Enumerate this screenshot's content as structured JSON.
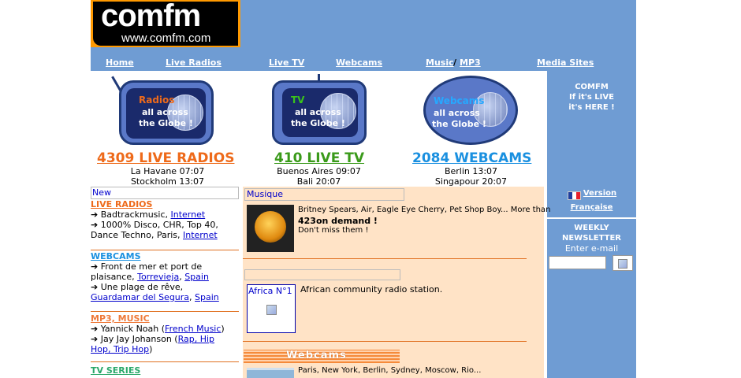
{
  "logo": {
    "name": "comfm",
    "url": "www.comfm.com"
  },
  "nav": {
    "home": "Home",
    "live_radios": "Live Radios",
    "live_tv": "Live TV",
    "webcams": "Webcams",
    "music": "Music",
    "separator": "/",
    "mp3": "MP3",
    "media_sites": "Media Sites"
  },
  "hero": {
    "radios": {
      "category": "Radios",
      "line1": "all across",
      "line2": "the Globe !",
      "count": "4309 LIVE RADIOS",
      "city1": "La Havane 07:07",
      "city2": "Stockholm 13:07",
      "color": "#ee6a1a"
    },
    "tv": {
      "category": "TV",
      "line1": "all across",
      "line2": "the Globe !",
      "count": "410 LIVE TV",
      "city1": "Buenos Aires 09:07",
      "city2": "Bali 20:07",
      "color": "#3a9a1a"
    },
    "webcams": {
      "category": "Webcams",
      "line1": "all across",
      "line2": "the Globe !",
      "count": "2084 WEBCAMS",
      "city1": "Berlin 13:07",
      "city2": "Singapour 20:07",
      "color": "#1a90e0"
    }
  },
  "right": {
    "tagline1": "COMFM",
    "tagline2": "If it's LIVE",
    "tagline3": "it's HERE !",
    "version1": "Version",
    "version2": "Française",
    "newsletter1": "WEEKLY",
    "newsletter2": "NEWSLETTER",
    "enter_email": "Enter e-mail",
    "email_value": ""
  },
  "left": {
    "new_label": "New",
    "radios": {
      "title": "LIVE RADIOS",
      "items": [
        {
          "text": "Badtrackmusic, ",
          "link": "Internet"
        },
        {
          "text": "1000% Disco, CHR, Top 40,",
          "text2": "Dance Techno, Paris, ",
          "link": "Internet"
        }
      ]
    },
    "webcams": {
      "title": "WEBCAMS",
      "item1_a": "Front de mer et port de",
      "item1_b": "plaisance, ",
      "item1_link1": "Torrevieja",
      "item1_sep": ", ",
      "item1_link2": "Spain",
      "item2_a": "Une plage de rêve,",
      "item2_link1": "Guardamar del Segura",
      "item2_sep": ", ",
      "item2_link2": "Spain"
    },
    "music": {
      "title": "MP3, MUSIC",
      "item1_a": "Yannick Noah (",
      "item1_link": "French Music",
      "item1_b": ")",
      "item2_a": "Jay Jay Johanson (",
      "item2_link1": "Rap, Hip",
      "item2_link2": "Hop, Trip Hop",
      "item2_b": ")"
    },
    "tv": {
      "title": "TV SERIES"
    }
  },
  "middle": {
    "music_header": "Musique",
    "music_line1": "Britney Spears, Air, Eagle Eye Cherry, Pet Shop Boy... More than",
    "music_line2": "423on demand !",
    "music_line3": "Don't miss them !",
    "africa_title": "Africa N°1",
    "africa_desc": "African community radio station.",
    "webcams_banner": "Webcams",
    "webcams_line": "Paris, New York, Berlin, Sydney, Moscow, Rio..."
  },
  "colors": {
    "header_blue": "#6f9cd3",
    "logo_orange": "#ff9900",
    "radios": "#ee6a1a",
    "tv": "#3a9a1a",
    "webcams": "#1a90e0",
    "music": "#ee7a3a",
    "tv_series": "#2aa86a",
    "mid_bg": "#ffe3c6"
  }
}
